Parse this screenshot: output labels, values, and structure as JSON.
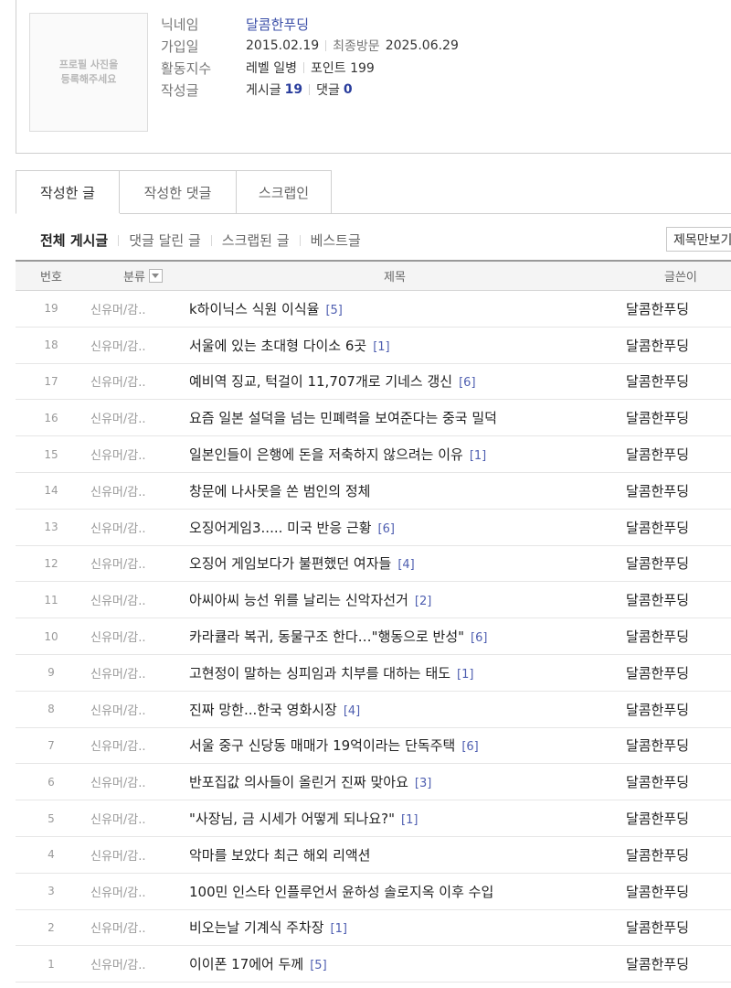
{
  "profile": {
    "photo_placeholder_line1": "프로필 사진을",
    "photo_placeholder_line2": "등록해주세요",
    "nickname_label": "닉네임",
    "nickname": "달콤한푸딩",
    "joined_label": "가입일",
    "joined": "2015.02.19",
    "last_visit_label": "최종방문",
    "last_visit": "2025.06.29",
    "activity_label": "활동지수",
    "level": "레벨 일병",
    "points": "포인트 199",
    "writing_label": "작성글",
    "posts_label": "게시글",
    "posts_count": "19",
    "comments_label": "댓글",
    "comments_count": "0"
  },
  "tabs": [
    {
      "label": "작성한 글",
      "active": true
    },
    {
      "label": "작성한 댓글",
      "active": false
    },
    {
      "label": "스크랩인",
      "active": false
    }
  ],
  "filters": [
    {
      "label": "전체 게시글",
      "active": true
    },
    {
      "label": "댓글 달린 글",
      "active": false
    },
    {
      "label": "스크랩된 글",
      "active": false
    },
    {
      "label": "베스트글",
      "active": false
    }
  ],
  "search_select": {
    "value": "제목만보기"
  },
  "board": {
    "headers": {
      "num": "번호",
      "category": "분류",
      "title": "제목",
      "author": "글쓴이"
    },
    "rows": [
      {
        "num": "19",
        "category": "신유머/감..",
        "title": "k하이닉스 식원 이식율",
        "comments": "[5]",
        "author": "달콤한푸딩"
      },
      {
        "num": "18",
        "category": "신유머/감..",
        "title": "서울에 있는 초대형 다이소 6곳",
        "comments": "[1]",
        "author": "달콤한푸딩"
      },
      {
        "num": "17",
        "category": "신유머/감..",
        "title": "예비역 징교, 턱걸이 11,707개로 기네스 갱신",
        "comments": "[6]",
        "author": "달콤한푸딩"
      },
      {
        "num": "16",
        "category": "신유머/감..",
        "title": "요즘 일본 설덕을 넘는 민폐력을 보여준다는 중국 밀덕",
        "comments": "",
        "author": "달콤한푸딩"
      },
      {
        "num": "15",
        "category": "신유머/감..",
        "title": "일본인들이 은행에 돈을 저축하지 않으려는 이유",
        "comments": "[1]",
        "author": "달콤한푸딩"
      },
      {
        "num": "14",
        "category": "신유머/감..",
        "title": "창문에 나사못을 쏜 범인의 정체",
        "comments": "",
        "author": "달콤한푸딩"
      },
      {
        "num": "13",
        "category": "신유머/감..",
        "title": "오징어게임3..... 미국 반응 근황",
        "comments": "[6]",
        "author": "달콤한푸딩"
      },
      {
        "num": "12",
        "category": "신유머/감..",
        "title": "오징어 게임보다가 불편했던 여자들",
        "comments": "[4]",
        "author": "달콤한푸딩"
      },
      {
        "num": "11",
        "category": "신유머/감..",
        "title": "아씨아씨 능선 위를 날리는 신악자선거",
        "comments": "[2]",
        "author": "달콤한푸딩"
      },
      {
        "num": "10",
        "category": "신유머/감..",
        "title": "카라큘라 복귀, 동물구조 한다…\"행동으로 반성\"",
        "comments": "[6]",
        "author": "달콤한푸딩"
      },
      {
        "num": "9",
        "category": "신유머/감..",
        "title": "고현정이 말하는 싱피임과 치부를 대하는 태도",
        "comments": "[1]",
        "author": "달콤한푸딩"
      },
      {
        "num": "8",
        "category": "신유머/감..",
        "title": "진짜 망한...한국 영화시장",
        "comments": "[4]",
        "author": "달콤한푸딩"
      },
      {
        "num": "7",
        "category": "신유머/감..",
        "title": "서울 중구 신당동 매매가 19억이라는 단독주택",
        "comments": "[6]",
        "author": "달콤한푸딩"
      },
      {
        "num": "6",
        "category": "신유머/감..",
        "title": "반포집값 의사들이 올린거 진짜 맞아요",
        "comments": "[3]",
        "author": "달콤한푸딩"
      },
      {
        "num": "5",
        "category": "신유머/감..",
        "title": "\"사장님, 금 시세가 어떻게 되나요?\"",
        "comments": "[1]",
        "author": "달콤한푸딩"
      },
      {
        "num": "4",
        "category": "신유머/감..",
        "title": "악마를 보았다 최근 해외 리액션",
        "comments": "",
        "author": "달콤한푸딩"
      },
      {
        "num": "3",
        "category": "신유머/감..",
        "title": "100민 인스타 인플루언서 윤하성 솔로지옥 이후 수입",
        "comments": "",
        "author": "달콤한푸딩"
      },
      {
        "num": "2",
        "category": "신유머/감..",
        "title": "비오는날 기계식 주차장",
        "comments": "[1]",
        "author": "달콤한푸딩"
      },
      {
        "num": "1",
        "category": "신유머/감..",
        "title": "이이폰 17에어 두께",
        "comments": "[5]",
        "author": "달콤한푸딩"
      }
    ]
  }
}
